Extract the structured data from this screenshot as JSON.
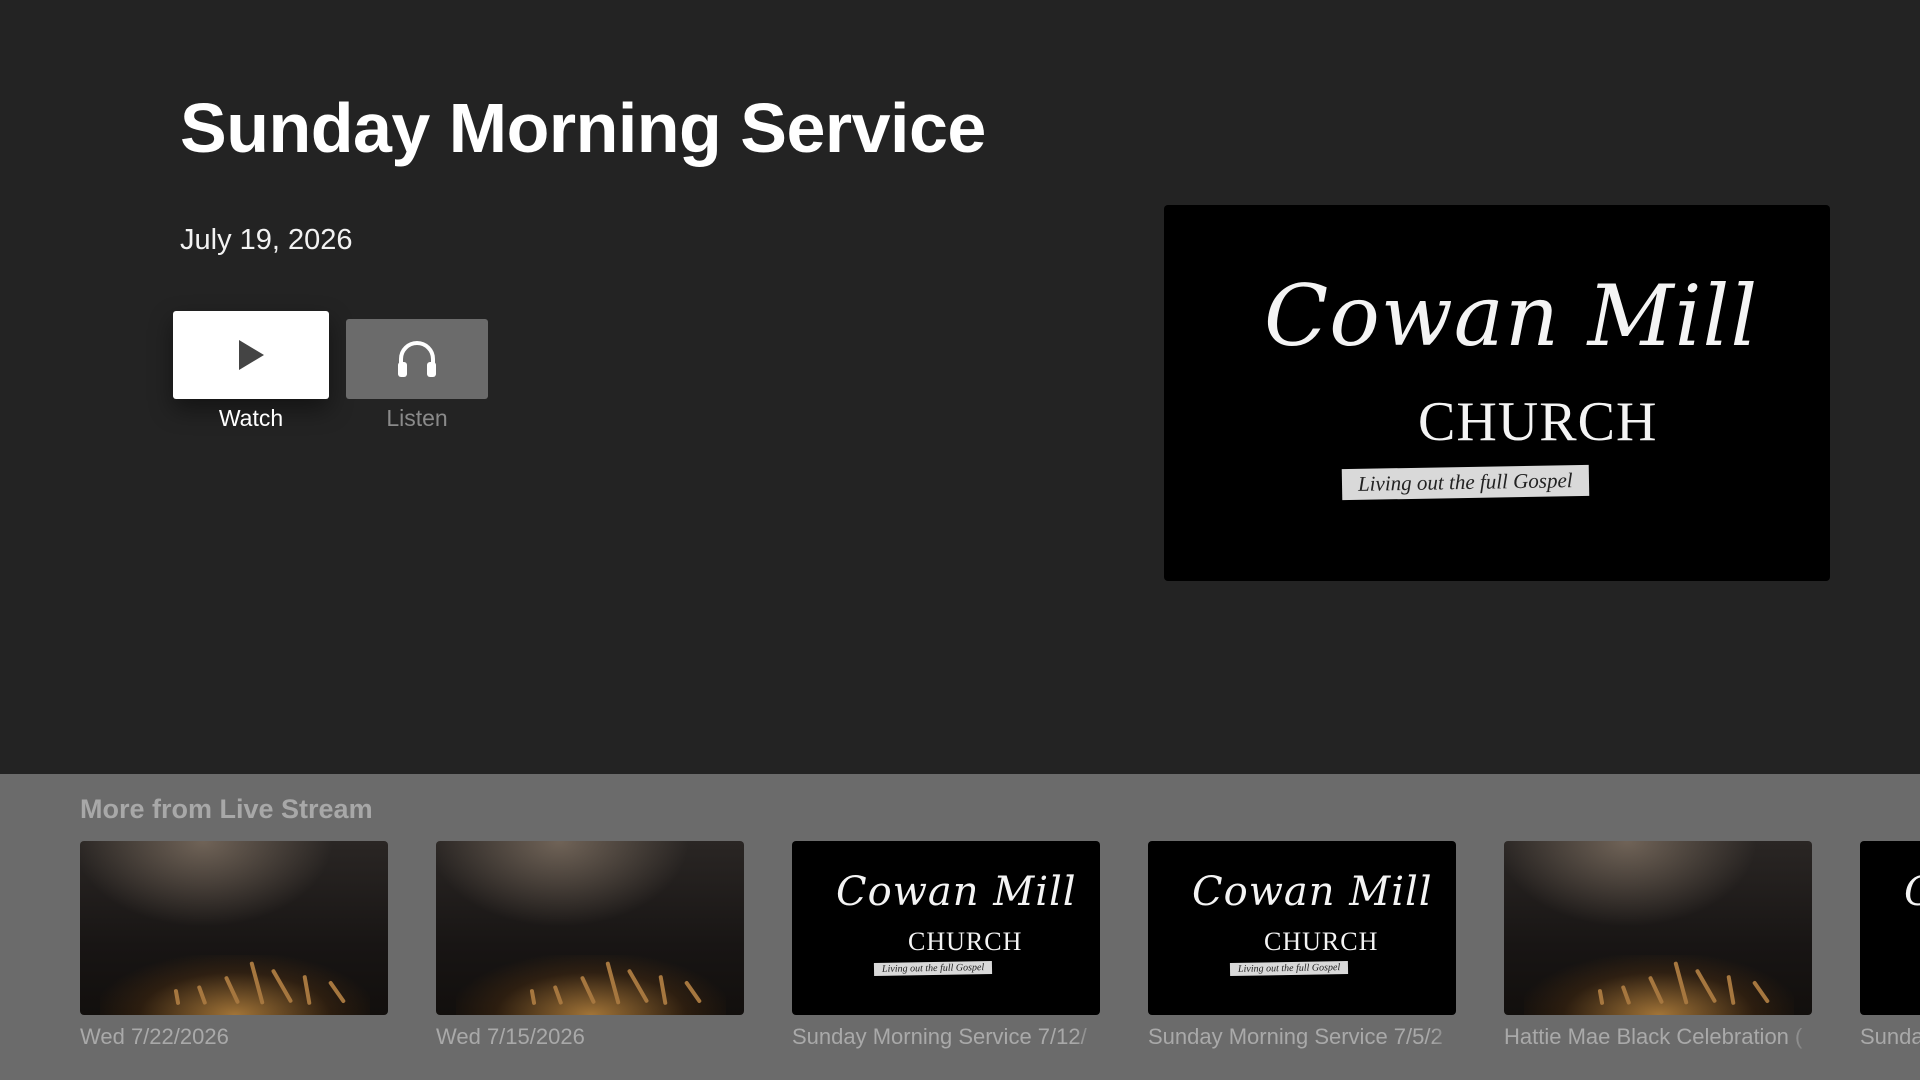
{
  "detail": {
    "title": "Sunday Morning Service",
    "date": "July 19, 2026",
    "watch_label": "Watch",
    "listen_label": "Listen",
    "artwork": {
      "line1": "Cowan Mill",
      "line2": "CHURCH",
      "tagline": "Living out the full Gospel"
    }
  },
  "shelf": {
    "title": "More from Live Stream",
    "items": [
      {
        "label": "Wed 7/22/2026",
        "thumb": "crowd"
      },
      {
        "label": "Wed 7/15/2026",
        "thumb": "crowd"
      },
      {
        "label": "Sunday Morning Service 7/12/",
        "thumb": "logo"
      },
      {
        "label": "Sunday Morning Service 7/5/2",
        "thumb": "logo"
      },
      {
        "label": "Hattie Mae Black Celebration (",
        "thumb": "crowd"
      },
      {
        "label": "Sunda",
        "thumb": "logo"
      }
    ]
  },
  "icons": {
    "watch": "play-icon",
    "listen": "headphones-icon"
  },
  "colors": {
    "background": "#232323",
    "shelf_background": "#6b6b6b",
    "focused_button": "#ffffff",
    "unfocused_button": "#6b6b6b"
  }
}
